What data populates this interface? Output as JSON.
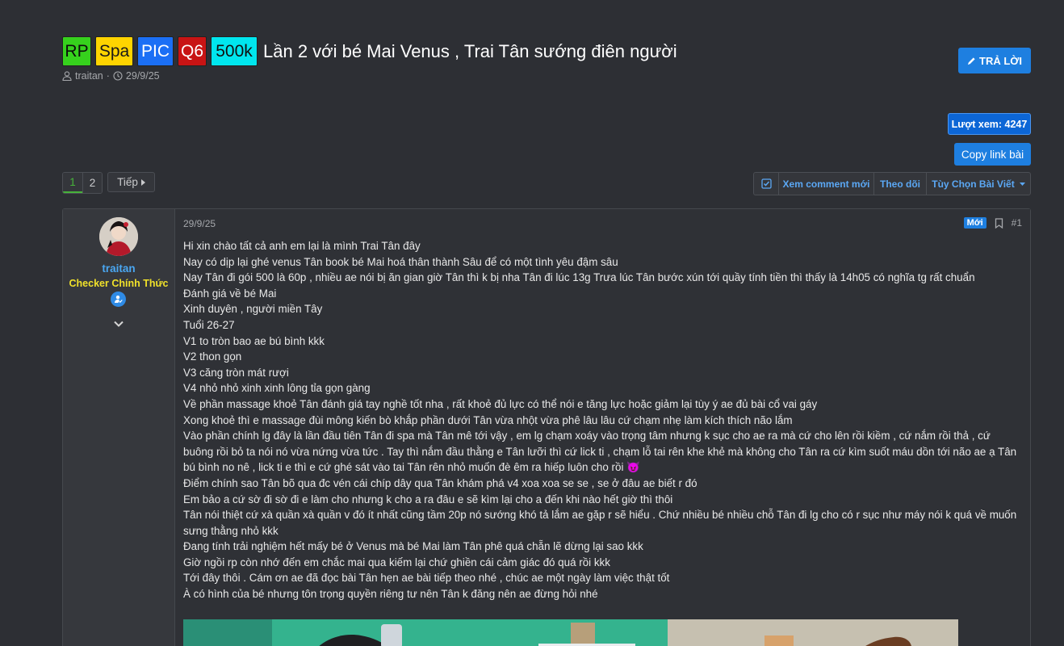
{
  "thread": {
    "tags": [
      "RP",
      "Spa",
      "PIC",
      "Q6",
      "500k"
    ],
    "title": "Lần 2 với bé Mai Venus , Trai Tân sướng điên người",
    "author": "traitan",
    "date": "29/9/25",
    "separator": "·"
  },
  "actions": {
    "reply_label": "TRẢ LỜI",
    "views_label": "Lượt xem: 4247",
    "copy_link_label": "Copy link bài"
  },
  "pagination": {
    "pages": [
      "1",
      "2"
    ],
    "current": "1",
    "next_label": "Tiếp"
  },
  "toolbar": {
    "new_comments": "Xem comment mới",
    "follow": "Theo dõi",
    "post_options": "Tùy Chọn Bài Viết"
  },
  "post": {
    "username": "traitan",
    "user_title": "Checker Chính Thức",
    "date": "29/9/25",
    "new_badge": "Mới",
    "number": "#1",
    "lines": [
      "Hi xin chào tất cả anh em lại là mình Trai Tân đây",
      "Nay có dịp lại ghé venus Tân book bé Mai hoá thân thành Sâu để có một tình yêu đậm sâu",
      "Nay Tân đi gói 500 là 60p , nhiều ae nói bị ăn gian giờ Tân thì k bị nha Tân đi lúc 13g Trưa lúc Tân bước xún tới quầy tính tiền thì thấy là 14h05 có nghĩa tg rất chuẩn",
      "Đánh giá về bé Mai",
      "Xinh duyên , người miền Tây",
      "Tuổi 26-27",
      "V1 to tròn bao ae bú bình kkk",
      "V2 thon gọn",
      "V3 căng tròn mát rượi",
      "V4 nhỏ nhỏ xinh xinh lông tỉa gọn gàng",
      "Về phần massage khoẻ Tân đánh giá tay nghề tốt nha , rất khoẻ đủ lực có thể nói e tăng lực hoặc giảm lại tùy ý ae đủ bài cổ vai gáy",
      "Xong khoẻ thì e massage đùi mông kiến bò khắp phần dưới Tân vừa nhột vừa phê lâu lâu cứ chạm nhẹ làm kích thích não lắm",
      "Vào phần chính lg đây là lần đầu tiên Tân đi spa mà Tân mê tới vậy , em lg chạm xoáy vào trọng tâm nhưng k sục cho ae ra mà cứ cho lên rồi kiềm , cứ nắm rồi thả , cứ buông rồi bỏ ta nói nó vừa nứng vừa tức . Tay thì nắm đầu thằng e Tân lưỡi thì cứ lick ti , chạm lỗ tai rên khe khẻ mà không cho Tân ra cứ kìm suốt máu dồn tới não ae ạ Tân bú bình no nê , lick ti e thì e cứ ghé sát vào tai Tân rên nhỏ muốn đè êm ra hiếp luôn cho rồi 😈",
      "Điểm chính sao Tân bõ qua đc vén cái chíp dây qua Tân khám phá v4 xoa xoa se se , se ở đâu ae biết r đó",
      "Em bảo a cứ sờ đi sờ đi e làm cho nhưng k cho a ra đâu e sẽ kìm lại cho a đến khi nào hết giờ thì thôi",
      "Tân nói thiệt cứ xà quần xà quần v đó ít nhất cũng tầm 20p nó sướng khó tả lắm ae gặp r sẽ hiểu . Chứ nhiều bé nhiều chỗ Tân đi lg cho có r sục như máy nói k quá về muốn sưng thằng nhỏ kkk",
      "Đang tính trải nghiệm hết mấy bé ở Venus mà bé Mai làm Tân phê quá chẵn lẽ dừng lại sao kkk",
      "Giờ ngồi rp còn nhớ đến em chắc mai qua kiếm lại chứ ghiền cái cảm giác đó quá rồi kkk",
      "Tới đây thôi . Cám ơn ae đã đọc bài Tân hẹn ae bài tiếp theo nhé , chúc ae một ngày làm việc thật tốt",
      "À có hình của bé nhưng tôn trọng quyền riêng tư nên Tân k đăng nên ae đừng hỏi nhé"
    ]
  },
  "colors": {
    "background": "#2d2f34",
    "accent": "#1e7fe0",
    "username": "#4aa7f2",
    "user_title": "#f0e12a",
    "pager_active": "#47b33a"
  }
}
